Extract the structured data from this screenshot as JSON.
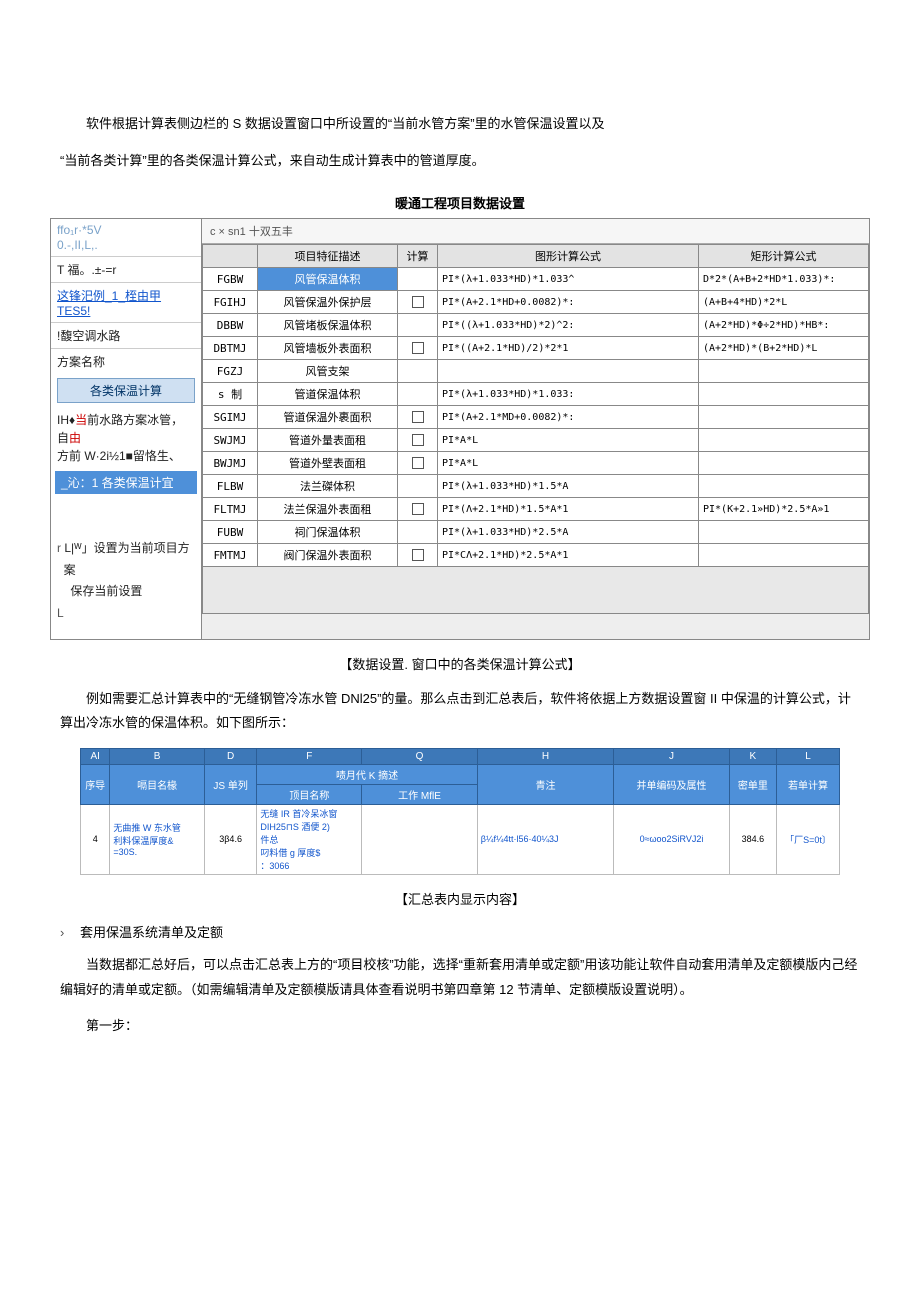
{
  "intro": {
    "p1": "软件根据计算表侧边栏的 S 数据设置窗口中所设置的“当前水管方案”里的水管保温设置以及",
    "p2": "“当前各类计算”里的各类保温计算公式，来自动生成计算表中的管道厚度。"
  },
  "settings_title": "暖通工程项目数据设置",
  "side": {
    "top1": "ffo₁r·*5V",
    "top2": "0.-,II,L,.",
    "line_t": "T 福。.±-=r",
    "line_example": "这锋汜例_1_桎由甲 TES5!",
    "line_water": "!馥空调水路",
    "label_plan": "方案名称",
    "btn_calc": "各类保温计算",
    "desc": "IH♦当前水路方案冰管，自由 方前 W·2i½1■留恪生、",
    "desc_red1": "当",
    "desc_red2": "由",
    "highlight": "_沁：1 各类保温计宜",
    "bottom1": "L|ᵂ」设置为当前项目方",
    "bottom2": "案",
    "bottom3": "保存当前设置",
    "r": "r",
    "L": "L"
  },
  "tabbar": "c × sn1 十双五丰",
  "cols": {
    "c1": "",
    "c2": "项目特征描述",
    "c3": "计算",
    "c4": "图形计算公式",
    "c5": "矩形计算公式"
  },
  "rows": [
    {
      "code": "FGBW",
      "desc": "风管保温体积",
      "chk": "",
      "g": "PI*(λ+1.033*HD)*1.033^",
      "r": "D*2*(A+B+2*HD*1.033)*:",
      "sel": true
    },
    {
      "code": "FGIHJ",
      "desc": "风管保温外保护层",
      "chk": "y",
      "g": "PI*(A+2.1*HD+0.0082)*:",
      "r": "(A+B+4*HD)*2*L"
    },
    {
      "code": "DBBW",
      "desc": "风管堵板保温体积",
      "chk": "",
      "g": "PI*((λ+1.033*HD)*2)^2:",
      "r": "(A+2*HD)*Φ÷2*HD)*HB*:"
    },
    {
      "code": "DBTMJ",
      "desc": "风管墙板外表面积",
      "chk": "y",
      "g": "PI*((A+2.1*HD)/2)*2*1",
      "r": "(A+2*HD)*(B+2*HD)*L"
    },
    {
      "code": "FGZJ",
      "desc": "风管支架",
      "chk": "",
      "g": "",
      "r": ""
    },
    {
      "code": "s 制",
      "desc": "管道保温体积",
      "chk": "",
      "g": "PI*(λ+1.033*HD)*1.033:",
      "r": ""
    },
    {
      "code": "SGIMJ",
      "desc": "管道保温外裹面积",
      "chk": "y",
      "g": "PI*(A+2.1*MD+0.0082)*:",
      "r": ""
    },
    {
      "code": "SWJMJ",
      "desc": "管道外量表面租",
      "chk": "y",
      "g": "PI*A*L",
      "r": ""
    },
    {
      "code": "BWJMJ",
      "desc": "管道外壁表面租",
      "chk": "y",
      "g": "PI*A*L",
      "r": ""
    },
    {
      "code": "FLBW",
      "desc": "法兰磔体积",
      "chk": "",
      "g": "PI*(λ+1.033*HD)*1.5*A",
      "r": ""
    },
    {
      "code": "FLTMJ",
      "desc": "法兰保温外表面租",
      "chk": "y",
      "g": "PI*(Λ+2.1*HD)*1.5*A*1",
      "r": "PI*(K+2.1»HD)*2.5*A»1"
    },
    {
      "code": "FUBW",
      "desc": "祠门保温体积",
      "chk": "",
      "g": "PI*(λ+1.033*HD)*2.5*A",
      "r": ""
    },
    {
      "code": "FMTMJ",
      "desc": "阀门保温外表面积",
      "chk": "y",
      "g": "PI*CΛ+2.1*HD)*2.5*A*1",
      "r": ""
    }
  ],
  "cap1": "【数据设置. 窗口中的各类保温计算公式】",
  "mid_p": "例如需要汇总计算表中的“无缝钢管冷冻水管 DNl25”的量。那么点击到汇总表后，软件将依据上方数据设置窗 II 中保温的计算公式，计算出冷冻水管的保温体积。如下图所示：",
  "summary": {
    "head_top": {
      "A": "AI",
      "B": "B",
      "D": "D",
      "F": "F",
      "Q": "Q",
      "H": "H",
      "J": "J",
      "K": "K",
      "L": "L"
    },
    "head2_span": "啧月代 K 摘述",
    "head3": {
      "c1": "序导",
      "c2": "嗝目名椽",
      "c3": "JS 单列",
      "c4": "顶目名称",
      "c5": "工作 MflE",
      "c6": "青注",
      "c7": "并单编码及属性",
      "c8": "密单里",
      "c9": "若单计算"
    },
    "row": {
      "c1": "4",
      "c2a": "无曲推 W 东水管",
      "c2b": "利料保温厚度&",
      "c2c": "=30S.",
      "c3": "3β4.6",
      "c4a": "无缝 IR 首冷呆冰窗",
      "c4b": "DIH25⊓S 酒便 2)",
      "c4c": "件总",
      "c4d": "叼料借 g 厚度$",
      "c4e": "：3066",
      "c6": "β¼f¼4tt·l56·40¼3J",
      "c7": "0≈ωoo2SiRVJ2i",
      "c8": "384.6",
      "c9": "「厂S=0t〕"
    }
  },
  "cap2": "【汇总表内显示内容】",
  "bullet": "套用保温系统清单及定额",
  "p3": "当数据都汇总好后，可以点击汇总表上方的“项目校核”功能，选择“重新套用清单或定额”用该功能让软件自动套用清单及定额模版内己经编辑好的清单或定额。（如需编辑清单及定额模版请具体查看说明书第四章第 12 节清单、定额模版设置说明）。",
  "p4": "第一步："
}
